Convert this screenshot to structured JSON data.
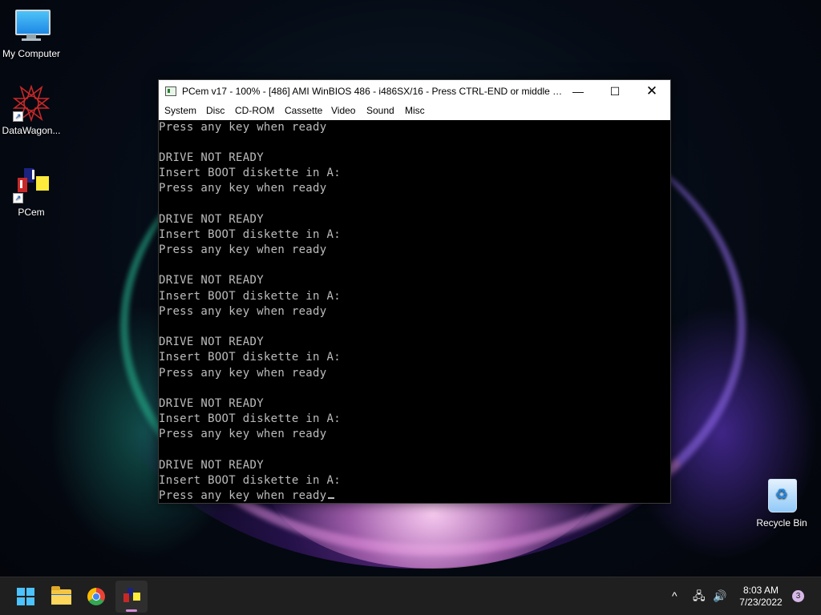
{
  "desktop": {
    "icons": [
      {
        "label": "My Computer",
        "icon": "computer-icon"
      },
      {
        "label": "DataWagon...",
        "icon": "datawagon-icon"
      },
      {
        "label": "PCem",
        "icon": "pcem-icon"
      },
      {
        "label": "Recycle Bin",
        "icon": "recycle-bin-icon"
      }
    ]
  },
  "window": {
    "title": "PCem v17 - 100% - [486] AMI WinBIOS 486 - i486SX/16 - Press CTRL-END or middle butt...",
    "controls": {
      "minimize": "—",
      "maximize": "☐",
      "close": "✕"
    },
    "menu": [
      "System",
      "Disc",
      "CD-ROM",
      "Cassette",
      "Video",
      "Sound",
      "Misc"
    ],
    "screen_lines": [
      "Press any key when ready",
      "",
      "DRIVE NOT READY",
      "Insert BOOT diskette in A:",
      "Press any key when ready",
      "",
      "DRIVE NOT READY",
      "Insert BOOT diskette in A:",
      "Press any key when ready",
      "",
      "DRIVE NOT READY",
      "Insert BOOT diskette in A:",
      "Press any key when ready",
      "",
      "DRIVE NOT READY",
      "Insert BOOT diskette in A:",
      "Press any key when ready",
      "",
      "DRIVE NOT READY",
      "Insert BOOT diskette in A:",
      "Press any key when ready",
      "",
      "DRIVE NOT READY",
      "Insert BOOT diskette in A:",
      "Press any key when ready"
    ],
    "screen_text_color": "#bcbcbc"
  },
  "taskbar": {
    "apps": [
      "start-icon",
      "file-explorer-icon",
      "chrome-icon",
      "pcem-icon"
    ],
    "tray": {
      "chevron": "^",
      "network": "🖧",
      "volume": "🔊"
    },
    "time": "8:03 AM",
    "date": "7/23/2022",
    "notification_count": "3",
    "accent": "#4cc2ff"
  }
}
